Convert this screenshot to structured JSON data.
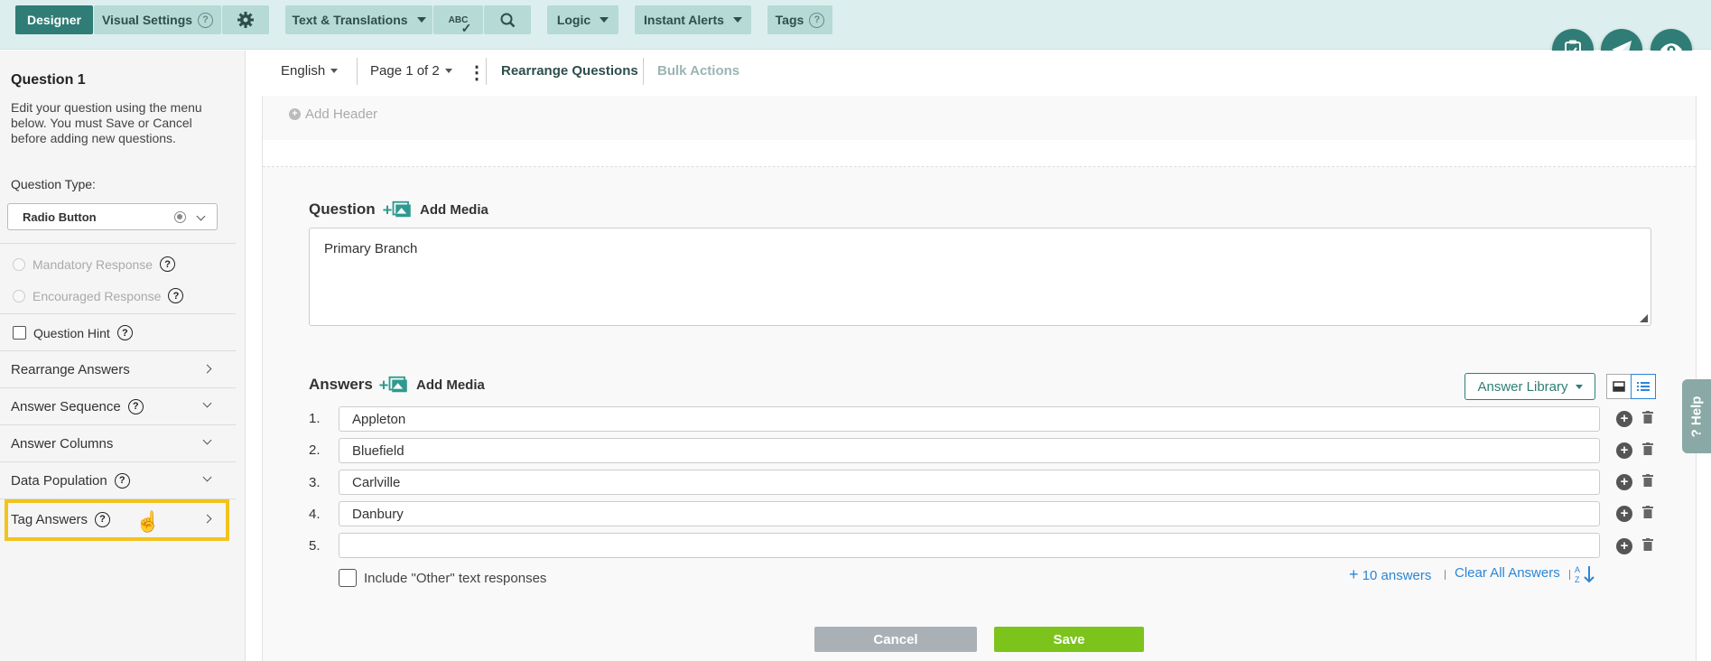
{
  "toolbar": {
    "designer": "Designer",
    "visual_settings": "Visual Settings",
    "text_translations": "Text & Translations",
    "spellcheck": "ABC",
    "logic": "Logic",
    "instant_alerts": "Instant Alerts",
    "tags": "Tags"
  },
  "subbar": {
    "language": "English",
    "page": "Page 1 of 2",
    "rearrange": "Rearrange Questions",
    "bulk": "Bulk Actions"
  },
  "sidebar": {
    "title": "Question 1",
    "description": "Edit your question using the menu below. You must Save or Cancel before adding new questions.",
    "question_type_label": "Question Type:",
    "question_type_value": "Radio Button",
    "options": [
      {
        "label": "Mandatory Response"
      },
      {
        "label": "Encouraged Response"
      },
      {
        "label": "Question Hint"
      }
    ],
    "rows": [
      {
        "label": "Rearrange Answers"
      },
      {
        "label": "Answer Sequence"
      },
      {
        "label": "Answer Columns"
      },
      {
        "label": "Data Population"
      },
      {
        "label": "Tag Answers"
      }
    ]
  },
  "canvas": {
    "add_header": "Add Header",
    "question_label": "Question",
    "add_media": "Add Media",
    "question_text": "Primary Branch",
    "answers_label": "Answers",
    "answer_library": "Answer Library",
    "answers": [
      {
        "num": "1.",
        "text": "Appleton"
      },
      {
        "num": "2.",
        "text": "Bluefield"
      },
      {
        "num": "3.",
        "text": "Carlville"
      },
      {
        "num": "4.",
        "text": "Danbury"
      },
      {
        "num": "5.",
        "text": ""
      }
    ],
    "include_other": "Include \"Other\" text responses",
    "add_answers": "10 answers",
    "clear_all": "Clear All Answers",
    "cancel": "Cancel",
    "save": "Save",
    "help": "Help"
  },
  "colors": {
    "brand": "#2f7d76",
    "toolbar_bg": "#dcefee",
    "link": "#2b86d6",
    "save": "#7cc41b",
    "cancel": "#a9b1b7",
    "highlight": "#f3c31d"
  }
}
